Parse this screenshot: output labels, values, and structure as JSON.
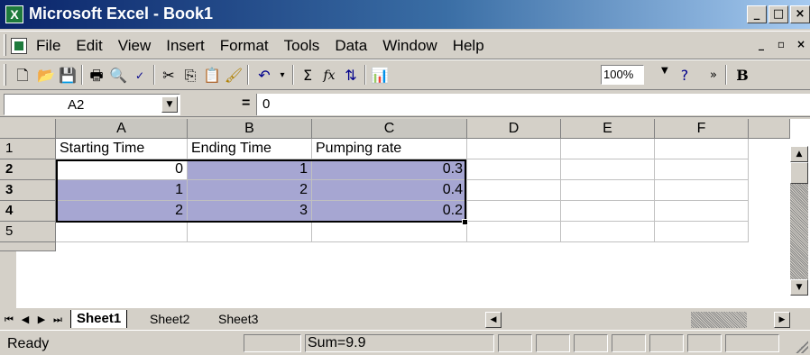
{
  "window": {
    "title": "Microsoft Excel - Book1",
    "caption_buttons": [
      "_",
      "□",
      "×"
    ],
    "doc_buttons": [
      "_",
      "▫",
      "×"
    ]
  },
  "menu": {
    "items": [
      {
        "label": "File"
      },
      {
        "label": "Edit"
      },
      {
        "label": "View"
      },
      {
        "label": "Insert"
      },
      {
        "label": "Format"
      },
      {
        "label": "Tools"
      },
      {
        "label": "Data"
      },
      {
        "label": "Window"
      },
      {
        "label": "Help"
      }
    ]
  },
  "toolbar": {
    "zoom": "100%",
    "sum_symbol": "Σ",
    "fx_symbol": "fx",
    "overflow": "»",
    "bold": "B"
  },
  "formula_bar": {
    "name_box": "A2",
    "equals": "=",
    "formula": "0"
  },
  "grid": {
    "columns": [
      "A",
      "B",
      "C",
      "D",
      "E",
      "F"
    ],
    "rows": [
      "1",
      "2",
      "3",
      "4",
      "5"
    ],
    "cells": {
      "r1": [
        "Starting Time",
        "Ending Time",
        "Pumping rate"
      ],
      "r2": [
        "0",
        "1",
        "0.3"
      ],
      "r3": [
        "1",
        "2",
        "0.4"
      ],
      "r4": [
        "2",
        "3",
        "0.2"
      ]
    }
  },
  "sheets": {
    "tabs": [
      "Sheet1",
      "Sheet2",
      "Sheet3"
    ],
    "active": "Sheet1"
  },
  "status": {
    "mode": "Ready",
    "sum": "Sum=9.9"
  },
  "colors": {
    "selection": "#a6a6d2",
    "chrome": "#d4d0c8",
    "title_start": "#0a246a"
  }
}
